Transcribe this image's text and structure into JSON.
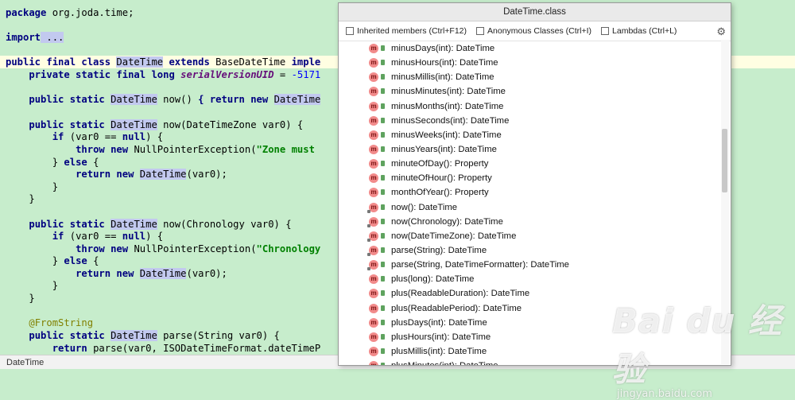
{
  "editor": {
    "lines": {
      "l1_a": "package",
      "l1_b": " org.joda.time;",
      "l2_a": "import",
      "l2_b": " ...",
      "l3_a": "public final class",
      "l3_b": "DateTime",
      "l3_c": "extends",
      "l3_d": " BaseDateTime ",
      "l3_e": "imple",
      "l4_a": "private static final long",
      "l4_b": "serialVersionUID",
      "l4_c": " = ",
      "l4_d": "-5171",
      "l5_a": "public static",
      "l5_b": "DateTime",
      "l5_c": " now() ",
      "l5_d": "{ return new",
      "l5_e": "DateTime",
      "l6_a": "public static",
      "l6_b": "DateTime",
      "l6_c": " now(DateTimeZone var0) {",
      "l7_a": "if",
      "l7_b": " (var0 == ",
      "l7_c": "null",
      "l7_d": ") {",
      "l8_a": "throw new",
      "l8_b": " NullPointerException(",
      "l8_c": "\"Zone must",
      "l9_a": "} ",
      "l9_b": "else",
      "l9_c": " {",
      "l10_a": "return new",
      "l10_b": "DateTime",
      "l10_c": "(var0);",
      "l11": "}",
      "l12": "}",
      "l13_a": "public static",
      "l13_b": "DateTime",
      "l13_c": " now(Chronology var0) {",
      "l14_a": "if",
      "l14_b": " (var0 == ",
      "l14_c": "null",
      "l14_d": ") {",
      "l15_a": "throw new",
      "l15_b": " NullPointerException(",
      "l15_c": "\"Chronology",
      "l16_a": "} ",
      "l16_b": "else",
      "l16_c": " {",
      "l17_a": "return new",
      "l17_b": "DateTime",
      "l17_c": "(var0);",
      "l18": "}",
      "l19": "}",
      "l20": "@FromString",
      "l21_a": "public static",
      "l21_b": "DateTime",
      "l21_c": " parse(String var0) {",
      "l22_a": "return",
      "l22_b": " parse(var0, ISODateTimeFormat.dateTimeP"
    }
  },
  "status_bar": {
    "text": "DateTime"
  },
  "popup": {
    "title": "DateTime.class",
    "options": {
      "inherited": "Inherited members (Ctrl+F12)",
      "anonymous": "Anonymous Classes (Ctrl+I)",
      "lambdas": "Lambdas (Ctrl+L)"
    },
    "icon_letter": "m",
    "members": [
      {
        "label": "minusDays(int): DateTime",
        "static": false
      },
      {
        "label": "minusHours(int): DateTime",
        "static": false
      },
      {
        "label": "minusMillis(int): DateTime",
        "static": false
      },
      {
        "label": "minusMinutes(int): DateTime",
        "static": false
      },
      {
        "label": "minusMonths(int): DateTime",
        "static": false
      },
      {
        "label": "minusSeconds(int): DateTime",
        "static": false
      },
      {
        "label": "minusWeeks(int): DateTime",
        "static": false
      },
      {
        "label": "minusYears(int): DateTime",
        "static": false
      },
      {
        "label": "minuteOfDay(): Property",
        "static": false
      },
      {
        "label": "minuteOfHour(): Property",
        "static": false
      },
      {
        "label": "monthOfYear(): Property",
        "static": false
      },
      {
        "label": "now(): DateTime",
        "static": true
      },
      {
        "label": "now(Chronology): DateTime",
        "static": true
      },
      {
        "label": "now(DateTimeZone): DateTime",
        "static": true
      },
      {
        "label": "parse(String): DateTime",
        "static": true
      },
      {
        "label": "parse(String, DateTimeFormatter): DateTime",
        "static": true
      },
      {
        "label": "plus(long): DateTime",
        "static": false
      },
      {
        "label": "plus(ReadableDuration): DateTime",
        "static": false
      },
      {
        "label": "plus(ReadablePeriod): DateTime",
        "static": false
      },
      {
        "label": "plusDays(int): DateTime",
        "static": false
      },
      {
        "label": "plusHours(int): DateTime",
        "static": false
      },
      {
        "label": "plusMillis(int): DateTime",
        "static": false
      },
      {
        "label": "plusMinutes(int): DateTime",
        "static": false
      }
    ]
  },
  "watermark": {
    "logo": "Bai du 经验",
    "url": "jingyan.baidu.com"
  }
}
